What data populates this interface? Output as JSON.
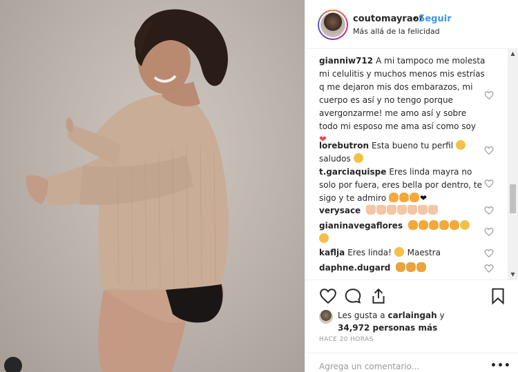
{
  "header": {
    "username": "coutomayraof",
    "separator": "•",
    "follow_label": "Seguir",
    "location": "Más allá de la felicidad"
  },
  "comments": [
    {
      "user": "gianniw712",
      "lines": [
        "A mi tampoco me molesta",
        "mi celulitis y muchos menos mis estrías",
        "q me dejaron mis dos embarazos, mi",
        "cuerpo es así y no tengo porque",
        "avergonzarme! me amo así y sobre",
        "todo mi esposo me ama así como soy"
      ],
      "emoji_line": "red-heart"
    },
    {
      "user": "lorebutron",
      "lines": [
        "Esta bueno tu perfil",
        "saludos"
      ]
    },
    {
      "user": "t.garciaquispe",
      "lines": [
        "Eres linda mayra no",
        "solo por fuera, eres bella por dentro, te",
        "sigo y te admiro"
      ]
    },
    {
      "user": "verysace",
      "lines": [
        ""
      ]
    },
    {
      "user": "gianinavegaflores",
      "lines": [
        ""
      ]
    },
    {
      "user": "kaflja",
      "lines": [
        "Eres linda!",
        "Maestra"
      ]
    },
    {
      "user": "daphne.dugard",
      "lines": [
        ""
      ]
    }
  ],
  "likes": {
    "prefix": "Les gusta a",
    "user": "carlaingah",
    "conjunction": "y",
    "count_text": "34,972 personas más"
  },
  "timestamp": "HACE 20 HORAS",
  "comment_input": {
    "placeholder": "Agrega un comentario..."
  },
  "more_label": "•••",
  "icons": {
    "like": "heart-outline-icon",
    "comment": "comment-bubble-icon",
    "share": "share-icon",
    "save": "bookmark-icon"
  }
}
